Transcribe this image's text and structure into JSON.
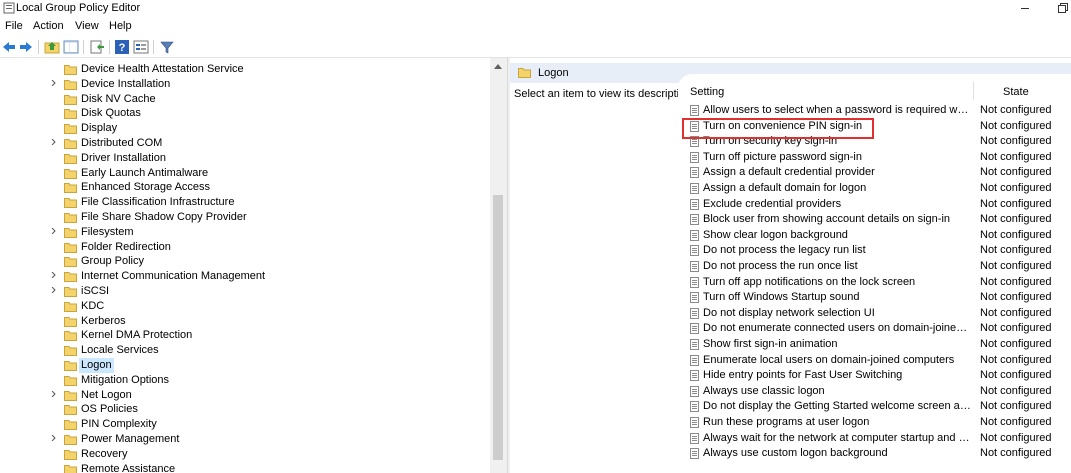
{
  "window": {
    "title": "Local Group Policy Editor"
  },
  "menubar": {
    "items": [
      "File",
      "Action",
      "View",
      "Help"
    ]
  },
  "toolbar": {
    "buttons": [
      "back-icon",
      "forward-icon",
      "up-folder-icon",
      "show-hide-tree-icon",
      "export-list-icon",
      "help-icon",
      "properties-icon",
      "filter-icon"
    ]
  },
  "tree": {
    "items": [
      {
        "label": "Device Health Attestation Service",
        "expandable": false
      },
      {
        "label": "Device Installation",
        "expandable": true
      },
      {
        "label": "Disk NV Cache",
        "expandable": false
      },
      {
        "label": "Disk Quotas",
        "expandable": false
      },
      {
        "label": "Display",
        "expandable": false
      },
      {
        "label": "Distributed COM",
        "expandable": true
      },
      {
        "label": "Driver Installation",
        "expandable": false
      },
      {
        "label": "Early Launch Antimalware",
        "expandable": false
      },
      {
        "label": "Enhanced Storage Access",
        "expandable": false
      },
      {
        "label": "File Classification Infrastructure",
        "expandable": false
      },
      {
        "label": "File Share Shadow Copy Provider",
        "expandable": false
      },
      {
        "label": "Filesystem",
        "expandable": true
      },
      {
        "label": "Folder Redirection",
        "expandable": false
      },
      {
        "label": "Group Policy",
        "expandable": false
      },
      {
        "label": "Internet Communication Management",
        "expandable": true
      },
      {
        "label": "iSCSI",
        "expandable": true
      },
      {
        "label": "KDC",
        "expandable": false
      },
      {
        "label": "Kerberos",
        "expandable": false
      },
      {
        "label": "Kernel DMA Protection",
        "expandable": false
      },
      {
        "label": "Locale Services",
        "expandable": false
      },
      {
        "label": "Logon",
        "expandable": false,
        "selected": true
      },
      {
        "label": "Mitigation Options",
        "expandable": false
      },
      {
        "label": "Net Logon",
        "expandable": true
      },
      {
        "label": "OS Policies",
        "expandable": false
      },
      {
        "label": "PIN Complexity",
        "expandable": false
      },
      {
        "label": "Power Management",
        "expandable": true
      },
      {
        "label": "Recovery",
        "expandable": false
      },
      {
        "label": "Remote Assistance",
        "expandable": false
      }
    ]
  },
  "right_pane": {
    "header_title": "Logon",
    "description": "Select an item to view its description.",
    "columns": {
      "setting": "Setting",
      "state": "State"
    },
    "rows": [
      {
        "name": "Allow users to select when a password is required when resuming from connected standby",
        "state": "Not configured"
      },
      {
        "name": "Turn on convenience PIN sign-in",
        "state": "Not configured"
      },
      {
        "name": "Turn on security key sign-in",
        "state": "Not configured"
      },
      {
        "name": "Turn off picture password sign-in",
        "state": "Not configured"
      },
      {
        "name": "Assign a default credential provider",
        "state": "Not configured"
      },
      {
        "name": "Assign a default domain for logon",
        "state": "Not configured"
      },
      {
        "name": "Exclude credential providers",
        "state": "Not configured"
      },
      {
        "name": "Block user from showing account details on sign-in",
        "state": "Not configured"
      },
      {
        "name": "Show clear logon background",
        "state": "Not configured"
      },
      {
        "name": "Do not process the legacy run list",
        "state": "Not configured"
      },
      {
        "name": "Do not process the run once list",
        "state": "Not configured"
      },
      {
        "name": "Turn off app notifications on the lock screen",
        "state": "Not configured"
      },
      {
        "name": "Turn off Windows Startup sound",
        "state": "Not configured"
      },
      {
        "name": "Do not display network selection UI",
        "state": "Not configured"
      },
      {
        "name": "Do not enumerate connected users on domain-joined computers",
        "state": "Not configured"
      },
      {
        "name": "Show first sign-in animation",
        "state": "Not configured"
      },
      {
        "name": "Enumerate local users on domain-joined computers",
        "state": "Not configured"
      },
      {
        "name": "Hide entry points for Fast User Switching",
        "state": "Not configured"
      },
      {
        "name": "Always use classic logon",
        "state": "Not configured"
      },
      {
        "name": "Do not display the Getting Started welcome screen at logon",
        "state": "Not configured"
      },
      {
        "name": "Run these programs at user logon",
        "state": "Not configured"
      },
      {
        "name": "Always wait for the network at computer startup and logon",
        "state": "Not configured"
      },
      {
        "name": "Always use custom logon background",
        "state": "Not configured"
      }
    ]
  },
  "colors": {
    "accent": "#cce8ff",
    "folder": "#f4d36b",
    "highlight": "#e03030"
  }
}
